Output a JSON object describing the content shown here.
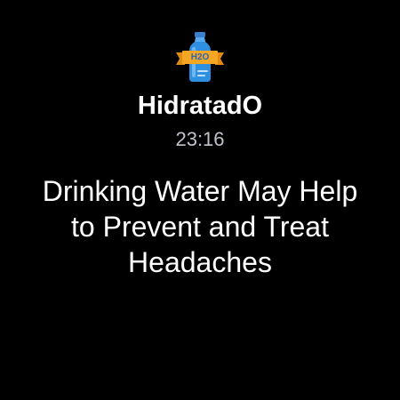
{
  "notification": {
    "app_icon": "water-bottle-h2o-icon",
    "app_icon_label": "H2O",
    "app_name": "HidratadO",
    "time": "23:16",
    "message": "Drinking Water May Help to Prevent and Treat Headaches"
  },
  "colors": {
    "background": "#000000",
    "title": "#ffffff",
    "time": "#bfc3c9",
    "bottle_blue": "#2f8fe0",
    "ribbon_orange": "#f5a623"
  }
}
